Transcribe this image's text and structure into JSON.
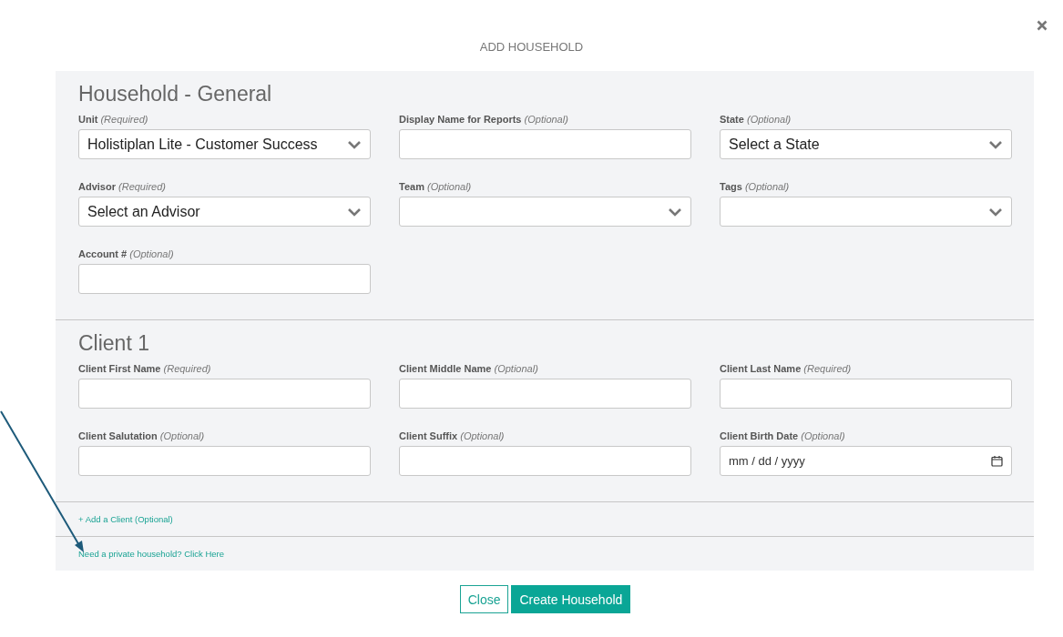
{
  "dialog": {
    "title": "ADD HOUSEHOLD"
  },
  "sections": [
    {
      "heading": "Household - General",
      "fields": [
        {
          "kind": "select",
          "label": "**Unit** *(Required)*",
          "value": "Holistiplan Lite - Customer Success"
        },
        {
          "kind": "text",
          "label": "**Display Name for Reports** *(Optional)*"
        },
        {
          "kind": "select",
          "label": "**State** *(Optional)*",
          "value": "Select a State"
        },
        {
          "kind": "select",
          "label": "**Advisor** *(Required)*",
          "value": "Select an Advisor"
        },
        {
          "kind": "select",
          "label": "**Team** *(Optional)*"
        },
        {
          "kind": "select",
          "label": "**Tags** *(Optional)*"
        },
        {
          "kind": "text",
          "label": "**Account #** *(Optional)*"
        }
      ]
    },
    {
      "heading": "Client 1",
      "fields": [
        {
          "kind": "text",
          "label": "**Client First Name** *(Required)*"
        },
        {
          "kind": "text",
          "label": "**Client Middle Name** *(Optional)*"
        },
        {
          "kind": "text",
          "label": "**Client Last Name** *(Required)*"
        },
        {
          "kind": "text",
          "label": "**Client Salutation** *(Optional)*"
        },
        {
          "kind": "text",
          "label": "**Client Suffix** *(Optional)*"
        },
        {
          "kind": "date",
          "label": "**Client Birth Date** *(Optional)*",
          "value": "mm / dd / yyyy"
        }
      ]
    }
  ],
  "add_client_link": "+ Add a Client (Optional)",
  "private_link": "Need a private household? Click Here",
  "buttons": [
    {
      "kind": "secondary",
      "label": "Close"
    },
    {
      "kind": "primary",
      "label": "Create Household"
    }
  ]
}
